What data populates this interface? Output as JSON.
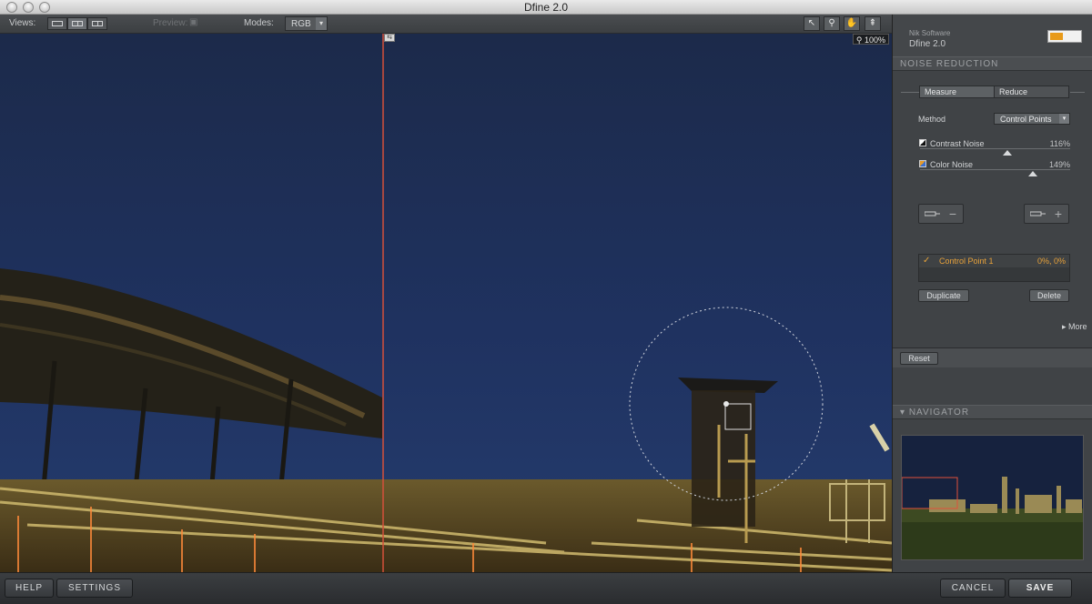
{
  "window": {
    "title": "Dfine 2.0"
  },
  "toolbar": {
    "views_label": "Views:",
    "preview_label": "Preview:",
    "modes_label": "Modes:",
    "mode_value": "RGB"
  },
  "canvas": {
    "zoom": "100%"
  },
  "panel": {
    "vendor": "Nik Software",
    "product": "Dfine 2.0",
    "noise_reduction_header": "NOISE REDUCTION",
    "tabs": [
      "Measure",
      "Reduce"
    ],
    "method_label": "Method",
    "method_value": "Control Points",
    "contrast_noise": {
      "label": "Contrast Noise",
      "value": "116%",
      "level": 0.58
    },
    "color_noise": {
      "label": "Color Noise",
      "value": "149%",
      "level": 0.75
    },
    "control_point": {
      "name": "Control Point 1",
      "value": "0%, 0%"
    },
    "duplicate_label": "Duplicate",
    "delete_label": "Delete",
    "more_label": "More",
    "reset_label": "Reset",
    "navigator_header": "NAVIGATOR"
  },
  "bottom": {
    "help": "HELP",
    "settings": "SETTINGS",
    "cancel": "CANCEL",
    "save": "SAVE"
  }
}
